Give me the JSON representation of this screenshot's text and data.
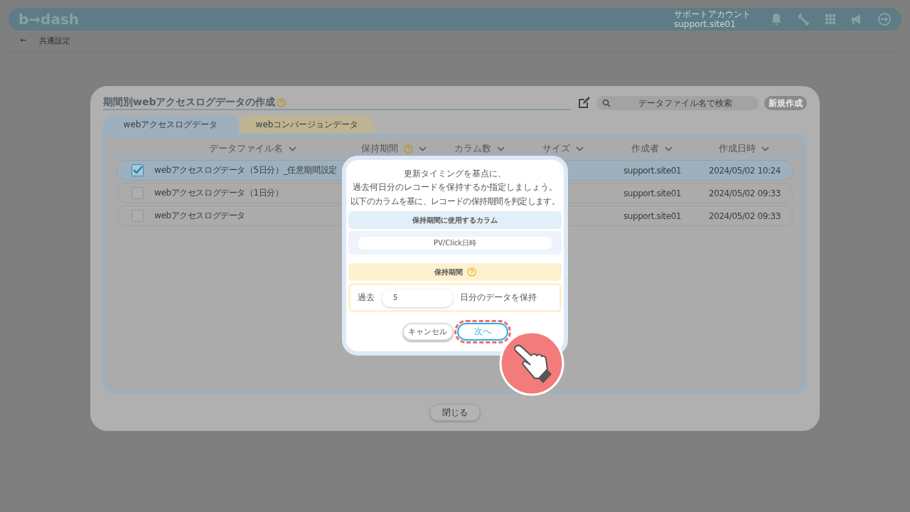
{
  "header": {
    "logo": "b→dash",
    "account_label": "サポートアカウント",
    "account_id": "support.site01"
  },
  "breadcrumb": {
    "back": "←",
    "label": "共通設定"
  },
  "modal": {
    "title": "期間別webアクセスログデータの作成",
    "search": {
      "placeholder": "データファイル名で検索"
    },
    "new_button": "新規作成",
    "tabs": [
      {
        "label": "webアクセスログデータ",
        "selected": true,
        "kind": "blue"
      },
      {
        "label": "webコンバージョンデータ",
        "selected": false,
        "kind": "yellow"
      }
    ],
    "columns": [
      {
        "label": "データファイル名",
        "help": false
      },
      {
        "label": "保持期間",
        "help": true
      },
      {
        "label": "カラム数",
        "help": false
      },
      {
        "label": "サイズ",
        "help": false
      },
      {
        "label": "作成者",
        "help": false
      },
      {
        "label": "作成日時",
        "help": false
      }
    ],
    "rows": [
      {
        "name": "webアクセスログデータ（5日分）_任意期間設定",
        "creator": "support.site01",
        "date": "2024/05/02 10:24",
        "checked": true,
        "selected": true
      },
      {
        "name": "webアクセスログデータ（1日分）",
        "creator": "support.site01",
        "date": "2024/05/02 09:33",
        "checked": false,
        "selected": false
      },
      {
        "name": "webアクセスログデータ",
        "creator": "support.site01",
        "date": "2024/05/02 09:33",
        "checked": false,
        "selected": false
      }
    ],
    "close_button": "閉じる"
  },
  "dialog": {
    "lead": [
      "更新タイミングを基点に、",
      "過去何日分のレコードを保持するか指定しましょう。"
    ],
    "note": "以下のカラムを基に、レコードの保持期間を判定します。",
    "column_section": {
      "title": "保持期間に使用するカラム",
      "value": "PV/Click日時"
    },
    "period_section": {
      "title": "保持期間",
      "prefix": "過去",
      "value": "5",
      "suffix": "日分のデータを保持"
    },
    "cancel_button": "キャンセル",
    "next_button": "次へ"
  }
}
